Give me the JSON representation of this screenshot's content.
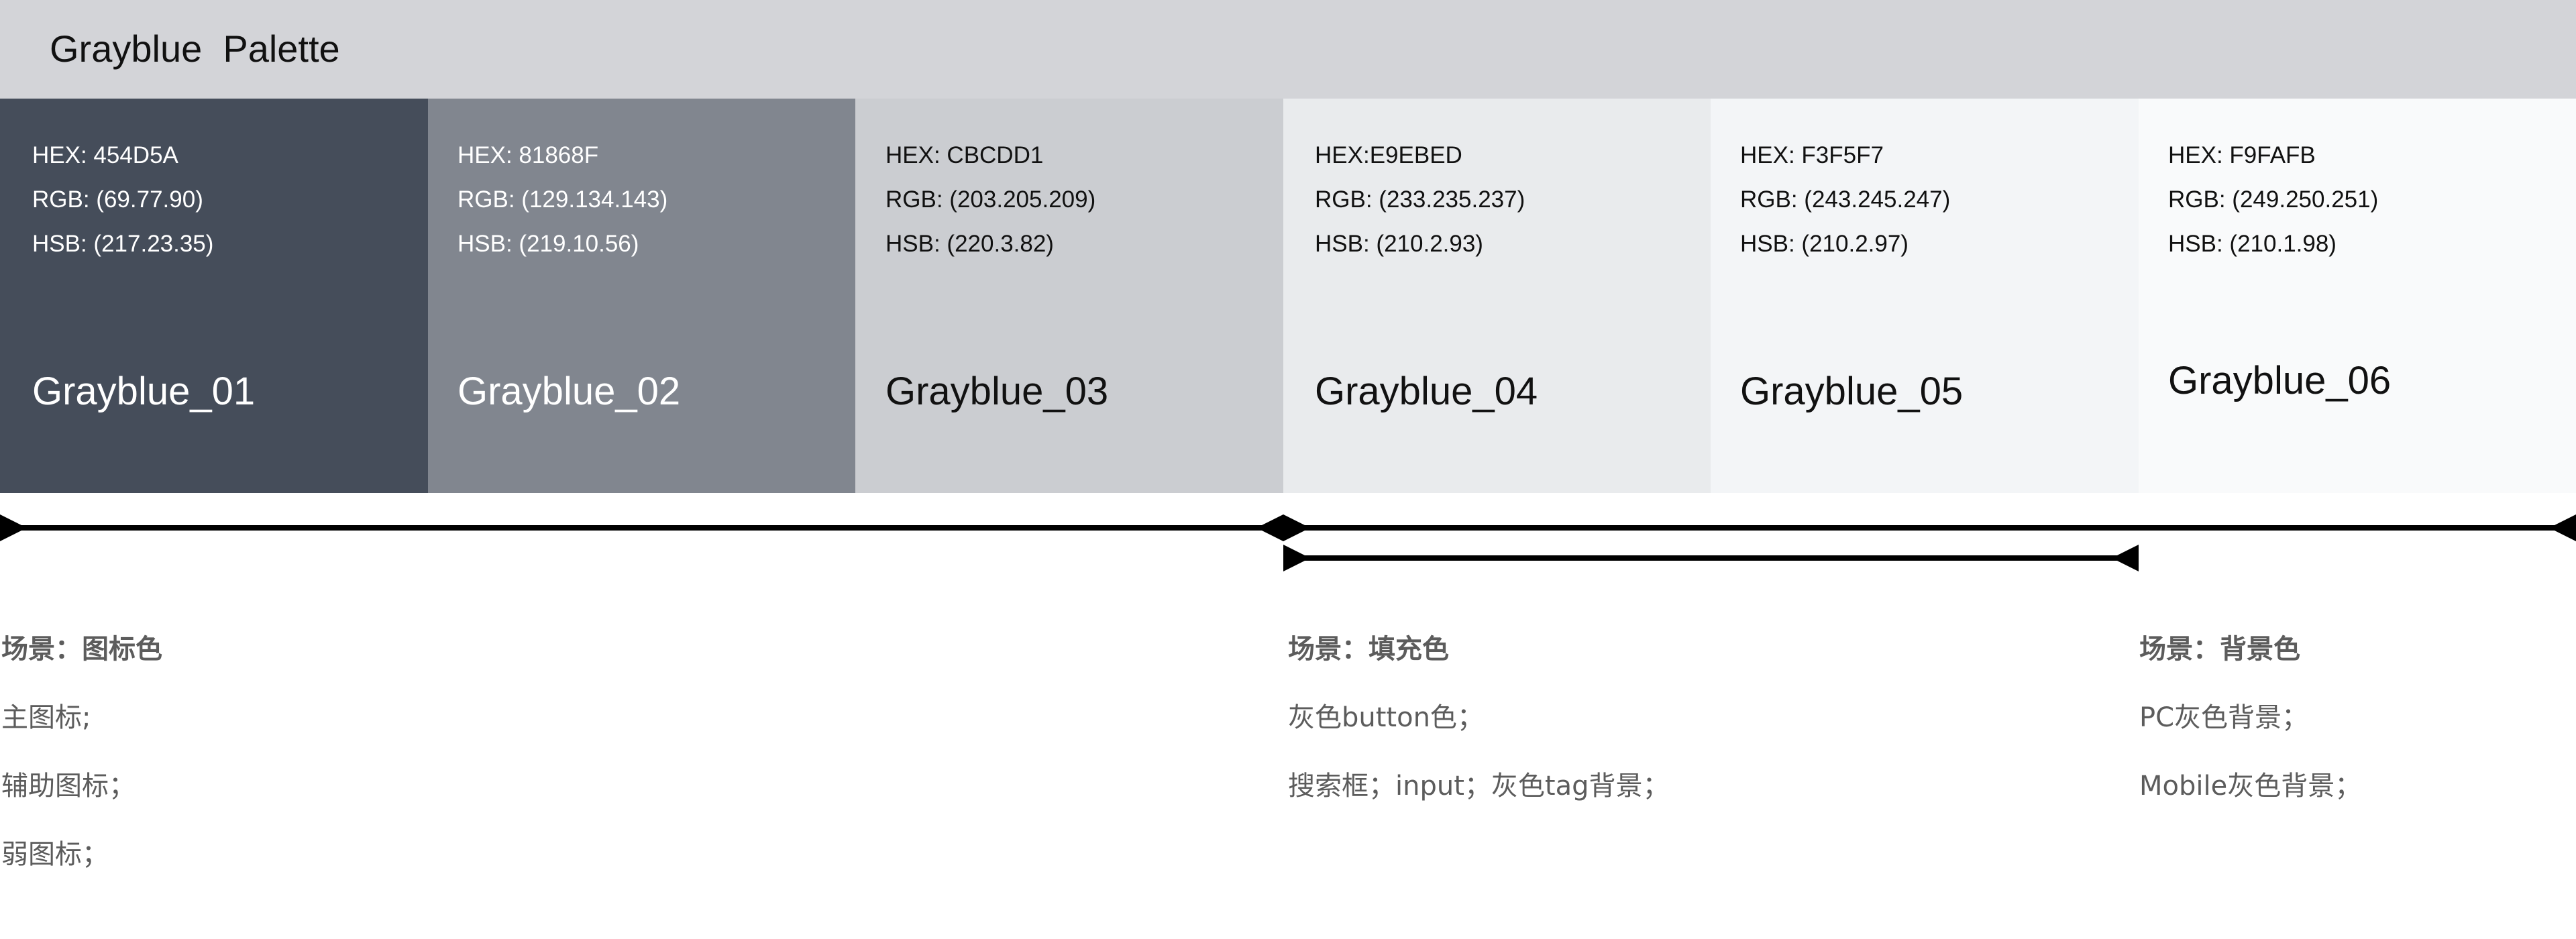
{
  "header": {
    "title": "Grayblue  Palette"
  },
  "swatches": [
    {
      "hex_label": "HEX: 454D5A",
      "rgb_label": "RGB: (69.77.90)",
      "hsb_label": "HSB: (217.23.35)",
      "name": "Grayblue_01",
      "color": "#454D5A"
    },
    {
      "hex_label": "HEX: 81868F",
      "rgb_label": "RGB: (129.134.143)",
      "hsb_label": "HSB: (219.10.56)",
      "name": "Grayblue_02",
      "color": "#81868F"
    },
    {
      "hex_label": "HEX: CBCDD1",
      "rgb_label": "RGB: (203.205.209)",
      "hsb_label": "HSB: (220.3.82)",
      "name": "Grayblue_03",
      "color": "#CBCDD1"
    },
    {
      "hex_label": "HEX:E9EBED",
      "rgb_label": "RGB: (233.235.237)",
      "hsb_label": "HSB: (210.2.93)",
      "name": "Grayblue_04",
      "color": "#E9EBED"
    },
    {
      "hex_label": "HEX: F3F5F7",
      "rgb_label": "RGB: (243.245.247)",
      "hsb_label": "HSB: (210.2.97)",
      "name": "Grayblue_05",
      "color": "#F3F5F7"
    },
    {
      "hex_label": "HEX: F9FAFB",
      "rgb_label": "RGB: (249.250.251)",
      "hsb_label": "HSB: (210.1.98)",
      "name": "Grayblue_06",
      "color": "#F9FAFB"
    }
  ],
  "scenarios": {
    "icon": {
      "title": "场景：图标色",
      "lines": [
        "主图标;",
        "辅助图标；",
        "弱图标；"
      ]
    },
    "fill": {
      "title": "场景：填充色",
      "lines": [
        "灰色button色；",
        "搜索框；input；灰色tag背景；"
      ]
    },
    "background": {
      "title": "场景：背景色",
      "lines": [
        "PC灰色背景；",
        "Mobile灰色背景；"
      ]
    }
  },
  "colors": {
    "header_bg": "#D3D4D8",
    "range_line": "#000000",
    "scenario_text": "#5C5C5C"
  }
}
